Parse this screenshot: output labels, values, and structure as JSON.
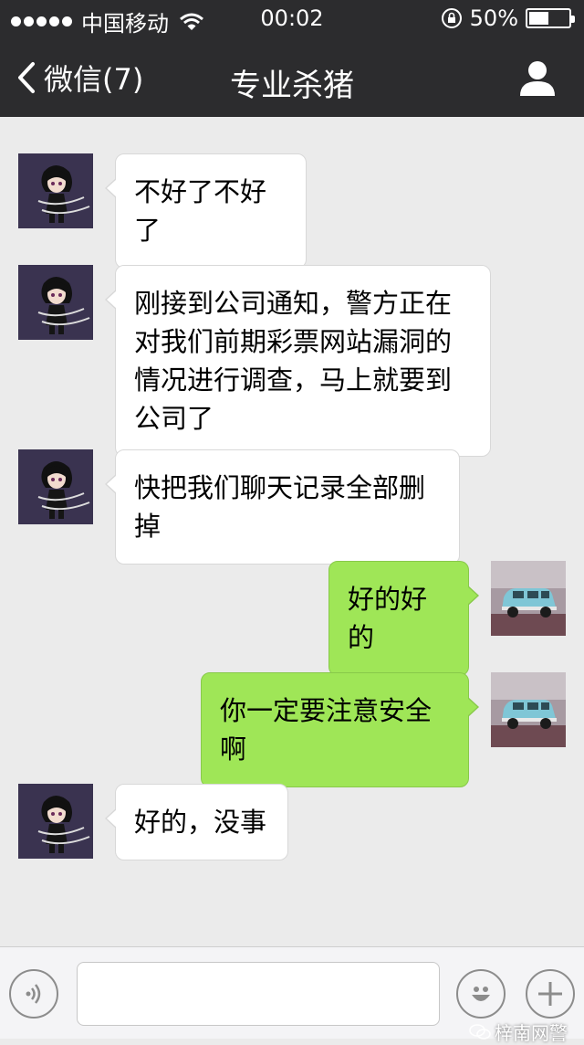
{
  "status_bar": {
    "carrier": "中国移动",
    "time": "00:02",
    "battery": "50%",
    "battery_level": 0.5
  },
  "nav": {
    "back_label": "微信(7)",
    "title": "专业杀猪"
  },
  "messages": [
    {
      "side": "in",
      "text": "不好了不好了"
    },
    {
      "side": "in",
      "text": "刚接到公司通知，警方正在对我们前期彩票网站漏洞的情况进行调查，马上就要到公司了"
    },
    {
      "side": "in",
      "text": "快把我们聊天记录全部删掉"
    },
    {
      "side": "out",
      "text": "好的好的"
    },
    {
      "side": "out",
      "text": "你一定要注意安全啊"
    },
    {
      "side": "in",
      "text": "好的，没事"
    }
  ],
  "input_bar": {
    "placeholder": "",
    "icons": [
      "voice-icon",
      "emoji-icon",
      "plus-icon"
    ]
  },
  "watermark": "梓南网警",
  "colors": {
    "nav_bg": "#2c2c2e",
    "chat_bg": "#ebebeb",
    "out_bubble": "#9fe657",
    "in_bubble": "#ffffff"
  }
}
